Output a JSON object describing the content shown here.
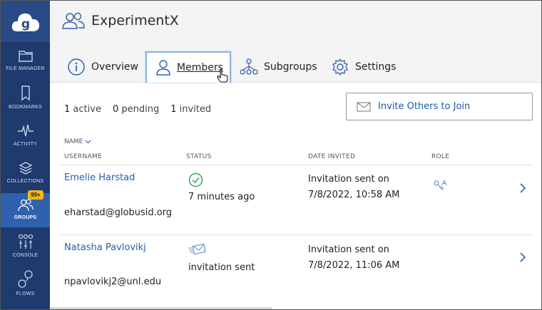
{
  "sidebar": {
    "items": [
      {
        "label": "FILE MANAGER",
        "icon": "folder-icon"
      },
      {
        "label": "BOOKMARKS",
        "icon": "bookmark-icon"
      },
      {
        "label": "ACTIVITY",
        "icon": "activity-icon"
      },
      {
        "label": "COLLECTIONS",
        "icon": "collections-icon"
      },
      {
        "label": "GROUPS",
        "icon": "groups-icon",
        "active": true
      },
      {
        "label": "CONSOLE",
        "icon": "console-icon"
      },
      {
        "label": "FLOWS",
        "icon": "flows-icon"
      }
    ],
    "groups_badge": "99+"
  },
  "header": {
    "title": "ExperimentX",
    "tabs": [
      {
        "label": "Overview",
        "icon": "info-icon"
      },
      {
        "label": "Members",
        "icon": "person-icon",
        "active": true
      },
      {
        "label": "Subgroups",
        "icon": "subgroups-icon"
      },
      {
        "label": "Settings",
        "icon": "gear-icon"
      }
    ]
  },
  "counts": {
    "active_num": "1",
    "active_label": "active",
    "pending_num": "0",
    "pending_label": "pending",
    "invited_num": "1",
    "invited_label": "invited"
  },
  "invite_button": "Invite Others to Join",
  "table": {
    "sort_label": "NAME",
    "columns": [
      "USERNAME",
      "STATUS",
      "DATE INVITED",
      "ROLE"
    ],
    "rows": [
      {
        "name": "Emelie Harstad",
        "email": "eharstad@globusid.org",
        "status": "7 minutes ago",
        "status_icon": "check-circle-icon",
        "date_line1": "Invitation sent on",
        "date_line2": "7/8/2022, 10:58 AM",
        "role_icon": "admin-key-icon"
      },
      {
        "name": "Natasha Pavlovikj",
        "email": "npavlovikj2@unl.edu",
        "status": "invitation sent",
        "status_icon": "envelope-sent-icon",
        "date_line1": "Invitation sent on",
        "date_line2": "7/8/2022, 11:06 AM",
        "role_icon": ""
      }
    ]
  },
  "colors": {
    "sidebar_bg": "#1e3a6e",
    "sidebar_active": "#2f62ad",
    "link": "#2360ad",
    "badge": "#f6b80f",
    "check": "#3aa04a"
  }
}
